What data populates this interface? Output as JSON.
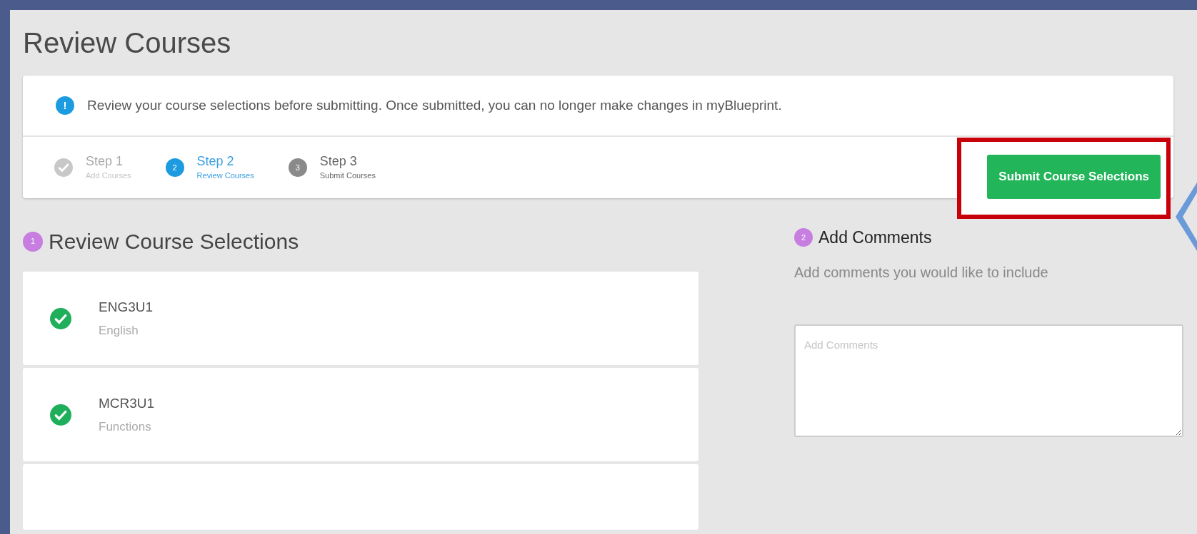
{
  "page": {
    "title": "Review Courses"
  },
  "notice": {
    "icon_text": "!",
    "text": "Review your course selections before submitting. Once submitted, you can no longer make changes in myBlueprint."
  },
  "steps": [
    {
      "title": "Step 1",
      "subtitle": "Add Courses",
      "completed": true,
      "selected": false
    },
    {
      "number": "2",
      "title": "Step 2",
      "subtitle": "Review Courses",
      "completed": false,
      "selected": true
    },
    {
      "number": "3",
      "title": "Step 3",
      "subtitle": "Submit Courses",
      "completed": false,
      "selected": false
    }
  ],
  "submit_button": {
    "label": "Submit Course Selections",
    "highlight_box": true,
    "pointer_arrow": true
  },
  "review": {
    "number": "1",
    "title": "Review Course Selections",
    "more_below": true,
    "courses": [
      {
        "code": "ENG3U1",
        "name": "English",
        "checked": true
      },
      {
        "code": "MCR3U1",
        "name": "Functions",
        "checked": true
      }
    ]
  },
  "comments": {
    "number": "2",
    "title": "Add Comments",
    "hint": "Add comments you would like to include",
    "placeholder": "Add Comments"
  }
}
